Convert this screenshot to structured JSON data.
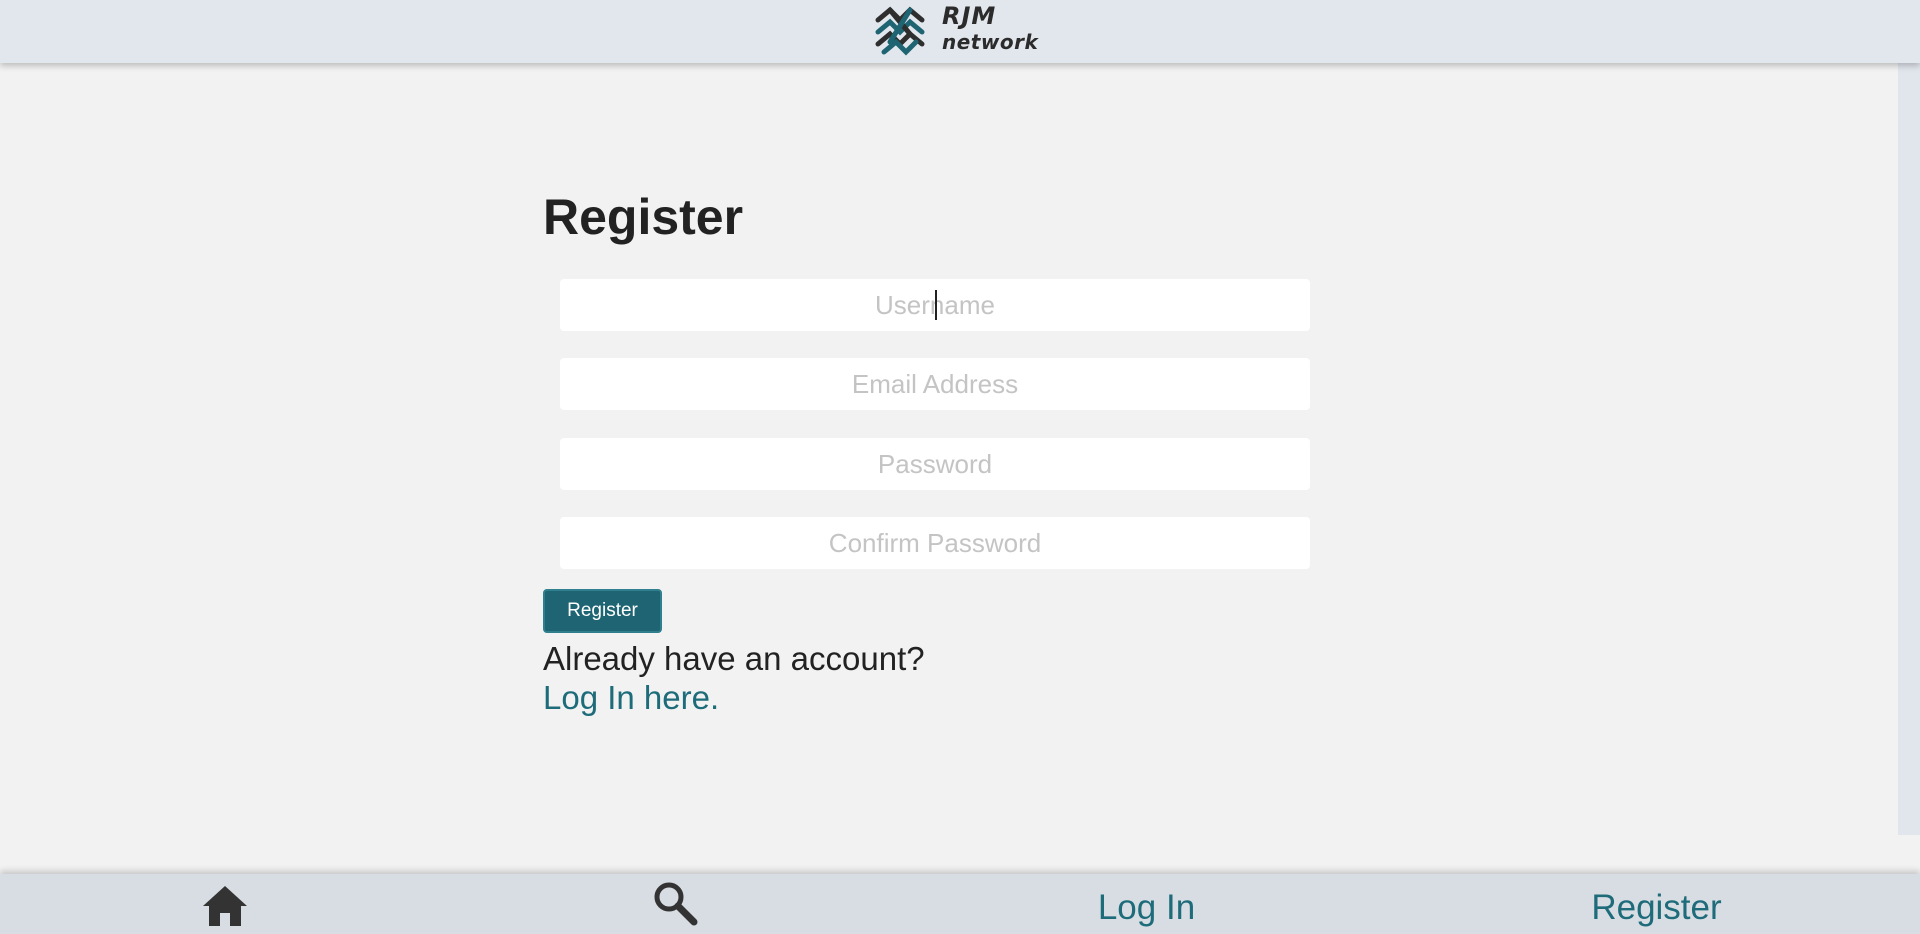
{
  "header": {
    "logo_line1": "RJM",
    "logo_line2": "network"
  },
  "main": {
    "title": "Register",
    "fields": {
      "username_placeholder": "Username",
      "email_placeholder": "Email Address",
      "password_placeholder": "Password",
      "confirm_password_placeholder": "Confirm Password"
    },
    "register_button_label": "Register",
    "already_text": "Already have an account?",
    "login_link_text": "Log In here."
  },
  "bottom_nav": {
    "home_icon": "home-icon",
    "search_icon": "search-icon",
    "login_label": "Log In",
    "register_label": "Register"
  },
  "colors": {
    "accent": "#1e6472",
    "link": "#1e6b7a",
    "header_bg": "#e2e6ed",
    "page_bg": "#f2f2f2",
    "icon": "#333333"
  }
}
